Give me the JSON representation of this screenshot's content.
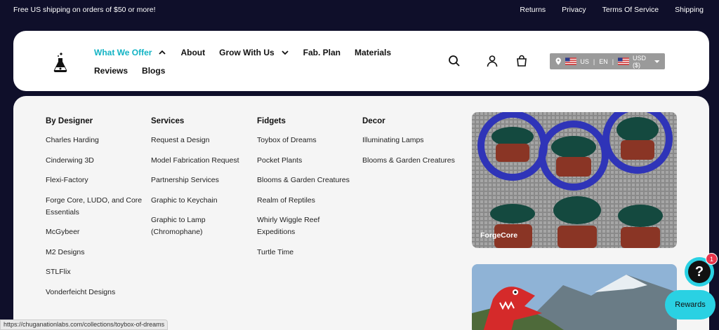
{
  "announcement": {
    "message": "Free US shipping on orders of $50 or more!",
    "links": [
      "Returns",
      "Privacy",
      "Terms Of Service",
      "Shipping"
    ]
  },
  "header": {
    "nav_row1": [
      {
        "label": "What We Offer",
        "active": true,
        "dropdown": "chevron-up-icon"
      },
      {
        "label": "About"
      },
      {
        "label": "Grow With Us",
        "dropdown": "chevron-down-icon"
      },
      {
        "label": "Fab. Plan"
      },
      {
        "label": "Materials"
      }
    ],
    "nav_row2": [
      {
        "label": "Reviews"
      },
      {
        "label": "Blogs"
      }
    ],
    "locale": {
      "country": "US",
      "language": "EN",
      "currency": "USD ($)"
    }
  },
  "mega_menu": {
    "columns": [
      {
        "title": "By Designer",
        "items": [
          "Charles Harding",
          "Cinderwing 3D",
          "Flexi-Factory",
          "Forge Core, LUDO, and Core Essentials",
          "McGybeer",
          "M2 Designs",
          "STLFlix",
          "Vonderfeicht Designs"
        ]
      },
      {
        "title": "Services",
        "items": [
          "Request a Design",
          "Model Fabrication Request",
          "Partnership Services",
          "Graphic to Keychain",
          "Graphic to Lamp (Chromophane)"
        ]
      },
      {
        "title": "Fidgets",
        "items": [
          "Toybox of Dreams",
          "Pocket Plants",
          "Blooms & Garden Creatures",
          "Realm of Reptiles",
          "Whirly Wiggle Reef Expeditions",
          "Turtle Time"
        ]
      },
      {
        "title": "Decor",
        "items": [
          "Illuminating Lamps",
          "Blooms & Garden Creatures"
        ]
      }
    ],
    "promo1_label": "ForgeCore"
  },
  "status_url": "https://chuganationlabs.com/collections/toybox-of-dreams",
  "widgets": {
    "help_badge": "1",
    "help_glyph": "?",
    "rewards_label": "Rewards"
  },
  "colors": {
    "accent": "#12b3c4",
    "widget": "#2ad1e3",
    "background": "#0f0f2a"
  }
}
